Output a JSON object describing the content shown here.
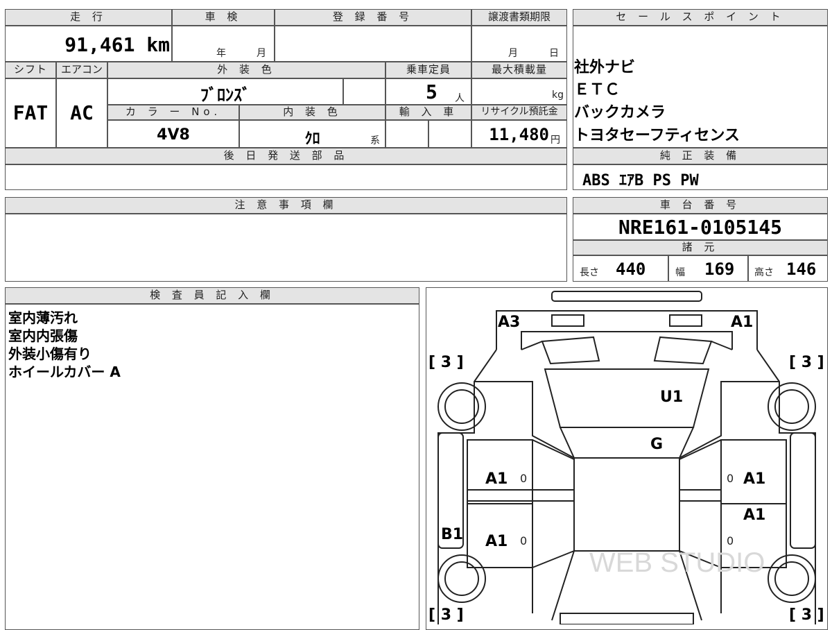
{
  "headers": {
    "mileage": "走 行",
    "shaken": "車 検",
    "reg_no": "登 録 番 号",
    "transfer_deadline": "譲渡書類期限",
    "sales_point": "セ ー ル ス ポ イ ン ト",
    "shift": "シフト",
    "aircon": "エアコン",
    "exterior_color": "外 装 色",
    "capacity": "乗車定員",
    "max_load": "最大積載量",
    "color_no": "カ ラ ー No.",
    "interior_color": "内 装 色",
    "import": "輸 入 車",
    "recycle": "リサイクル預託金",
    "later_parts": "後 日 発 送 部 品",
    "genuine_equipment": "純 正 装 備",
    "notes": "注 意 事 項 欄",
    "chassis_no": "車 台 番 号",
    "specs": "諸 元",
    "inspector": "検 査 員 記 入 欄"
  },
  "values": {
    "mileage": "91,461 km",
    "year_unit": "年",
    "month_unit": "月",
    "deadline_month": "月",
    "deadline_day": "日",
    "shift": "FAT",
    "aircon": "AC",
    "exterior_color": "ﾌﾞﾛﾝｽﾞ",
    "capacity": "5",
    "capacity_unit": "人",
    "load_unit": "kg",
    "color_no": "4V8",
    "interior_color": "ｸﾛ",
    "interior_suffix": "系",
    "recycle": "11,480",
    "recycle_unit": "円",
    "chassis_no": "NRE161-0105145",
    "length_label": "長さ",
    "length": "440",
    "width_label": "幅",
    "width": "169",
    "height_label": "高さ",
    "height": "146",
    "genuine_equipment": "ABS ｴｱB PS PW"
  },
  "sales_points": [
    "社外ナビ",
    "ＥＴＣ",
    "バックカメラ",
    "トヨタセーフティセンス"
  ],
  "inspector_notes": [
    "室内薄汚れ",
    "室内内張傷",
    "外装小傷有り",
    "ホイールカバー A"
  ],
  "diagram": {
    "codes": {
      "front_left": "A3",
      "front_right": "A1",
      "roof": "U1",
      "windshield": "G",
      "left_front_door": "A1",
      "right_front_door": "A1",
      "right_rear_upper": "A1",
      "left_rear_door": "A1",
      "left_rocker": "B1",
      "tire_fl": "[ 3 ]",
      "tire_fr": "[ 3 ]",
      "tire_rl": "[ 3 ]",
      "tire_rr": "[ 3 ]",
      "zero": "0"
    },
    "watermark": "WEB STUDIO"
  }
}
